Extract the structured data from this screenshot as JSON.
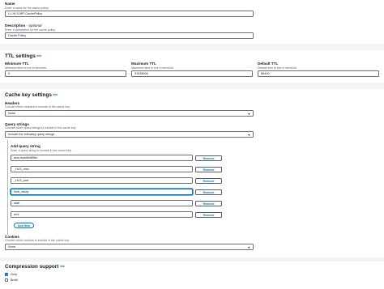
{
  "general": {
    "name_label": "Name",
    "name_hint": "Enter a name for the cache policy.",
    "name_value": "LL-HLS-MP-CachePolicy",
    "desc_label": "Description",
    "desc_optional": " - optional",
    "desc_hint": "Enter a description for the cache policy.",
    "desc_value": "Cache Policy"
  },
  "ttl": {
    "title": "TTL settings",
    "info": "Info",
    "min_label": "Minimum TTL",
    "min_hint": "Minimum time to live in seconds.",
    "min_value": "0",
    "max_label": "Maximum TTL",
    "max_hint": "Maximum time to live in seconds.",
    "max_value": "31536000",
    "def_label": "Default TTL",
    "def_hint": "Default time to live in seconds.",
    "def_value": "86400"
  },
  "cache_key": {
    "title": "Cache key settings",
    "info": "Info",
    "headers_label": "Headers",
    "headers_hint": "Choose which headers to include in the cache key.",
    "headers_value": "None",
    "qs_label": "Query strings",
    "qs_hint": "Choose which query strings to include in the cache key.",
    "qs_value": "Include the following query strings",
    "add_qs_label": "Add query string",
    "add_qs_hint": "Enter a query string to include in the cache key.",
    "query_strings": [
      "aws.manifestfilter",
      "_HLS_msn",
      "_HLS_part",
      "time_delay",
      "start",
      "end"
    ],
    "remove_label": "Remove",
    "add_item_label": "Add item",
    "cookies_label": "Cookies",
    "cookies_hint": "Choose which cookies to include in the cache key.",
    "cookies_value": "None"
  },
  "compression": {
    "title": "Compression support",
    "info": "Info",
    "gzip_label": "Gzip",
    "gzip_checked": true,
    "brotli_label": "Brotli",
    "brotli_checked": false
  },
  "colors": {
    "accent": "#0073bb",
    "text": "#16191f",
    "hint": "#545b64",
    "border": "#687078",
    "page_bg": "#f2f3f3"
  }
}
